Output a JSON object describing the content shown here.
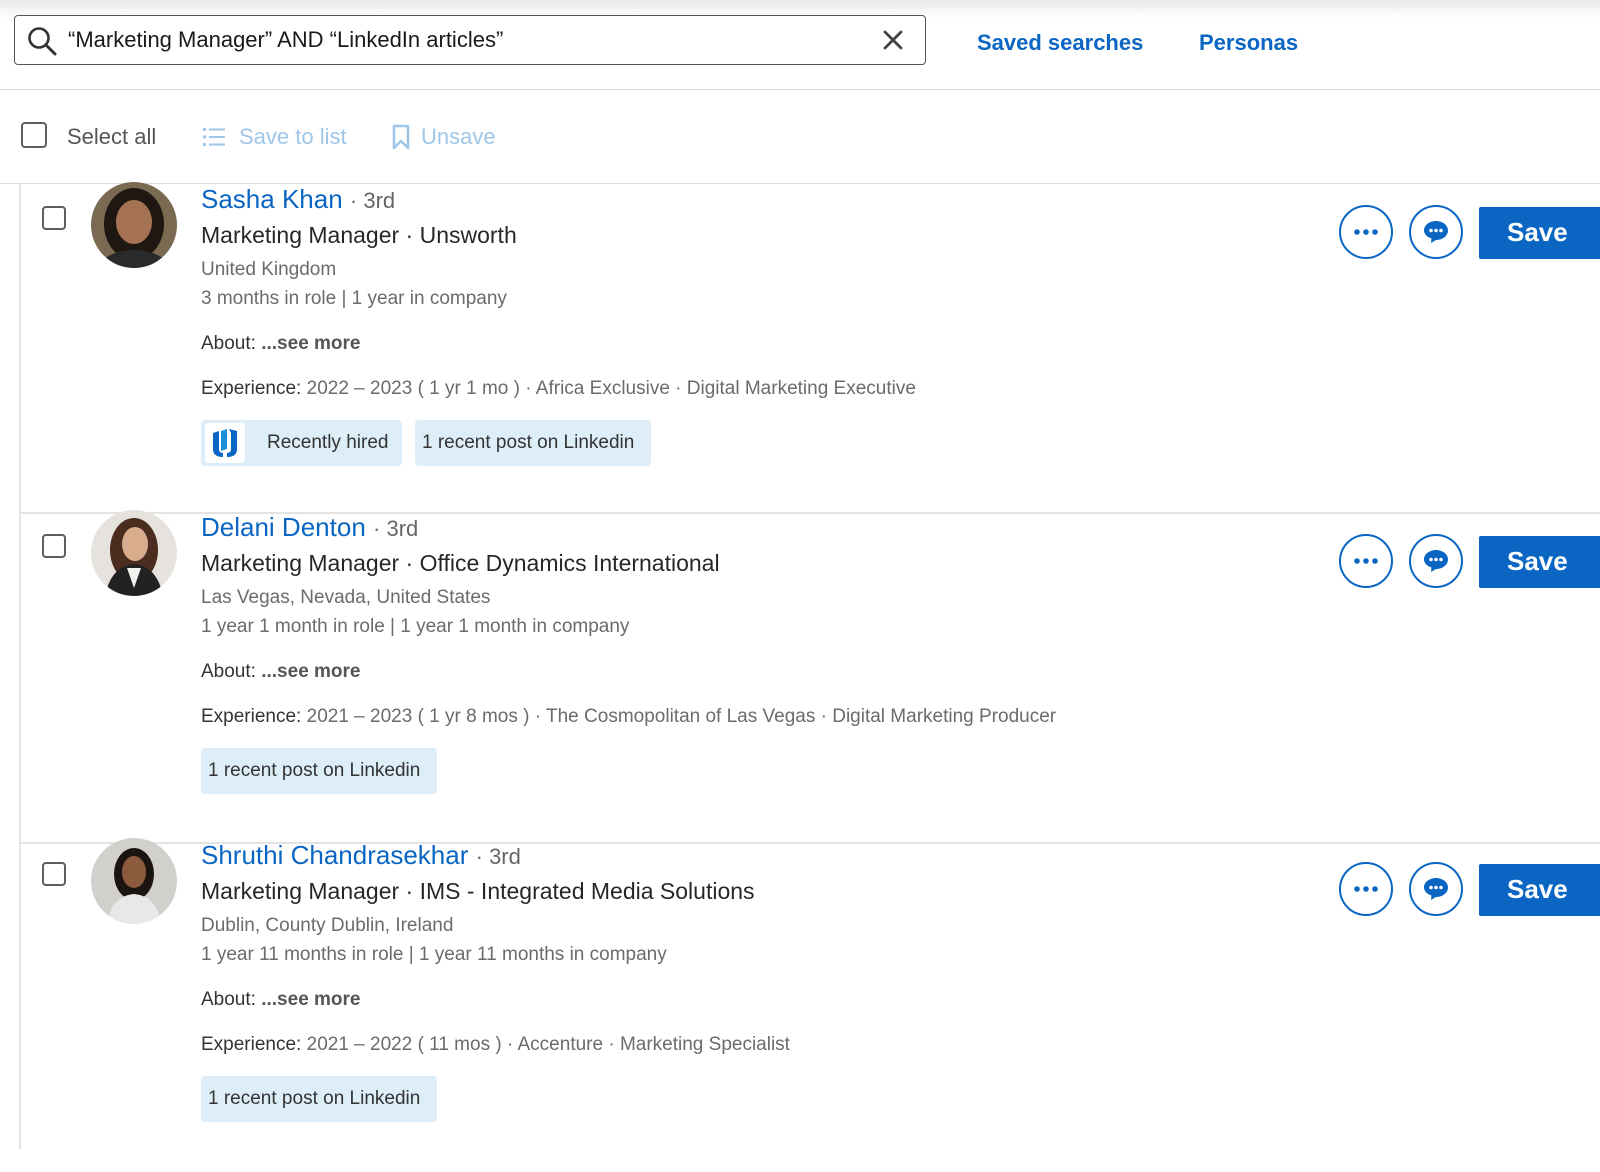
{
  "search": {
    "value": "“Marketing Manager” AND “LinkedIn articles”"
  },
  "header": {
    "saved_searches": "Saved searches",
    "personas": "Personas"
  },
  "toolbar": {
    "select_all": "Select all",
    "save_to_list": "Save to list",
    "unsave": "Unsave"
  },
  "results": [
    {
      "name": "Sasha Khan",
      "degree": "· 3rd",
      "role": "Marketing Manager",
      "company": "· Unsworth",
      "location": "United Kingdom",
      "tenure": "3 months in role | 1 year in company",
      "about_label": "About:",
      "see_more": "...see more",
      "experience_label": "Experience:",
      "experience": "2022 – 2023 ( 1 yr 1 mo ) · Africa Exclusive · Digital Marketing Executive",
      "chip_hired": "Recently hired",
      "chip_post": "1 recent post on Linkedin",
      "save": "Save"
    },
    {
      "name": "Delani Denton",
      "degree": "· 3rd",
      "role": "Marketing Manager",
      "company": "· Office Dynamics International",
      "location": "Las Vegas, Nevada, United States",
      "tenure": "1 year 1 month in role | 1 year 1 month in company",
      "about_label": "About:",
      "see_more": "...see more",
      "experience_label": "Experience:",
      "experience": "2021 – 2023 ( 1 yr 8 mos ) · The Cosmopolitan of Las Vegas · Digital Marketing Producer",
      "chip_post": "1 recent post on Linkedin",
      "save": "Save"
    },
    {
      "name": "Shruthi Chandrasekhar",
      "degree": "· 3rd",
      "role": "Marketing Manager",
      "company": "· IMS - Integrated Media Solutions",
      "location": "Dublin, County Dublin, Ireland",
      "tenure": "1 year 11 months in role | 1 year 11 months in company",
      "about_label": "About:",
      "see_more": "...see more",
      "experience_label": "Experience:",
      "experience": "2021 – 2022 ( 11 mos ) · Accenture · Marketing Specialist",
      "chip_post": "1 recent post on Linkedin",
      "save": "Save"
    }
  ],
  "colors": {
    "brand": "#0a66c2",
    "chip": "#ddeef9",
    "disabled": "#9fc6e8"
  },
  "icons": {
    "search": "search-icon",
    "clear": "close-icon",
    "list": "list-icon",
    "bookmark": "bookmark-icon",
    "more": "more-icon",
    "message": "message-icon"
  }
}
